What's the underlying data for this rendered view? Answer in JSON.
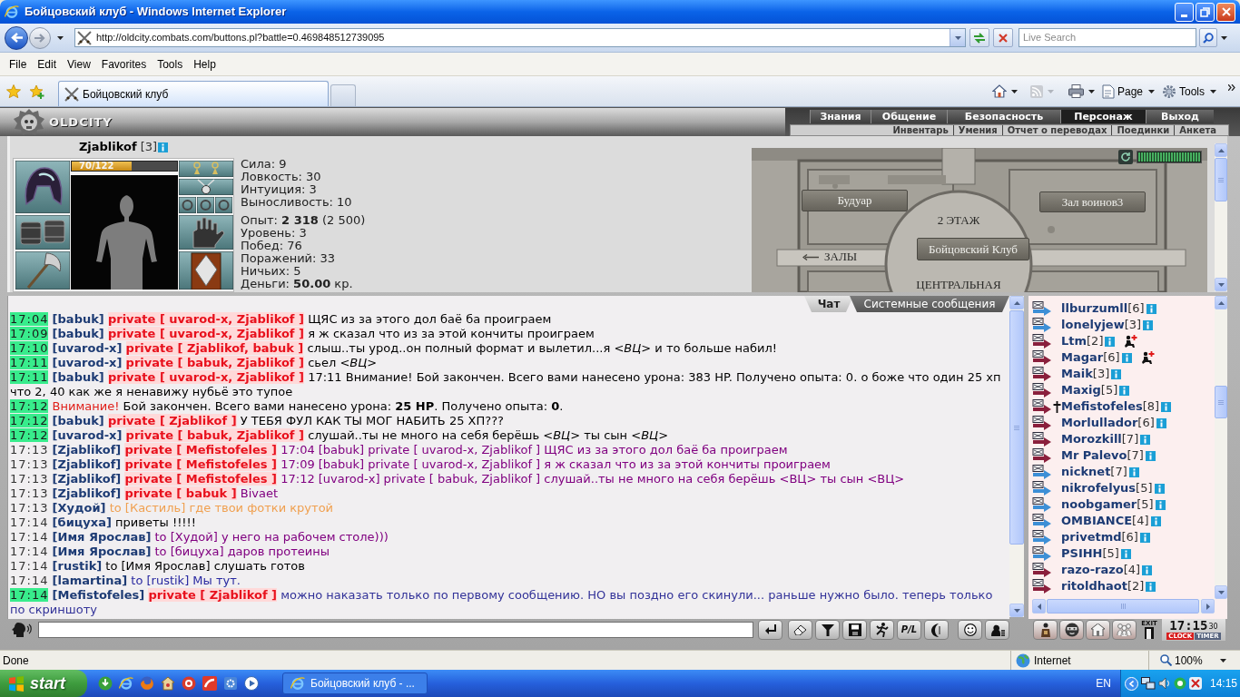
{
  "window": {
    "title": "Бойцовский клуб - Windows Internet Explorer"
  },
  "address_bar": {
    "url": "http://oldcity.combats.com/buttons.pl?battle=0.469848512739095",
    "search": {
      "placeholder": "Live Search"
    }
  },
  "menu_bar": [
    "File",
    "Edit",
    "View",
    "Favorites",
    "Tools",
    "Help"
  ],
  "tabs": [
    {
      "label": "Бойцовский клуб",
      "selected": true
    }
  ],
  "command_bar": [
    {
      "label": "Page"
    },
    {
      "label": "Tools"
    }
  ],
  "game": {
    "logo": "OLDCITY",
    "main_menu": [
      {
        "label": "Знания",
        "selected": false
      },
      {
        "label": "Общение",
        "selected": false
      },
      {
        "label": "Безопасность",
        "selected": false
      },
      {
        "label": "Персонаж",
        "selected": true
      },
      {
        "label": "Выход",
        "selected": false
      }
    ],
    "sub_menu": [
      "Инвентарь",
      "Умения",
      "Отчет о переводах",
      "Поединки",
      "Анкета"
    ],
    "character": {
      "name": "Zjablikof",
      "level": "[3]",
      "hp": {
        "reading": "70/122",
        "level": 0.57
      }
    },
    "stats": [
      [
        "Сила: 9",
        "Ловкость: 30",
        "Интуиция: 3",
        "Выносливость: 10"
      ],
      [
        "Опыт: **2 318** (2 500)",
        "Уровень: 3",
        "Побед: 76",
        "Поражений: 33",
        "Ничьих: 5",
        "Деньги: **50.00** кр."
      ]
    ],
    "map": {
      "labels": [
        {
          "text": "Будуар",
          "kind": "banner"
        },
        {
          "text": "Зал воинов3",
          "kind": "banner"
        },
        {
          "text": "2 ЭТАЖ",
          "kind": "caption"
        },
        {
          "text": "Бойцовский Клуб",
          "kind": "banner"
        },
        {
          "text": "ЗАЛЫ",
          "kind": "exit"
        },
        {
          "text": "ЦЕНТРАЛЬНАЯ",
          "kind": "caption"
        }
      ],
      "timer": {
        "level": 1
      }
    },
    "chat": {
      "tabs": [
        {
          "label": "Чат",
          "selected": true
        },
        {
          "label": "Системные сообщения",
          "selected": false
        }
      ],
      "messages": [
        {
          "time": "17:04",
          "highlight": true,
          "kind": "private",
          "sender": "[babuk]",
          "address": "private [ uvarod-x, Zjablikof ]",
          "text": "ЩЯС из за этого дол баё ба проиграем",
          "color": "#000000"
        },
        {
          "time": "17:09",
          "highlight": true,
          "kind": "private",
          "sender": "[babuk]",
          "address": "private [ uvarod-x, Zjablikof ]",
          "text": "я ж сказал что из за этой кончиты проиграем",
          "color": "#000000"
        },
        {
          "time": "17:10",
          "highlight": true,
          "kind": "private",
          "sender": "[uvarod-x]",
          "address": "private [ Zjablikof, babuk ]",
          "text": "слыш..ты урод..он полный формат и вылетил...я *<ВЦ>* и то больше набил!",
          "color": "#000000"
        },
        {
          "time": "17:11",
          "highlight": true,
          "kind": "private",
          "sender": "[uvarod-x]",
          "address": "private [ babuk, Zjablikof ]",
          "text": "сьел *<ВЦ>*",
          "color": "#000000"
        },
        {
          "time": "17:11",
          "highlight": true,
          "kind": "private",
          "sender": "[babuk]",
          "address": "private [ uvarod-x, Zjablikof ]",
          "text": "17:11 Внимание! Бой закончен. Всего вами нанесено урона: 383 HP. Получено опыта: 0. о боже что один 25 хп что 2, 40 как же я ненавижу нубьё это тупое",
          "color": "#000000"
        },
        {
          "time": "17:12",
          "highlight": true,
          "kind": "system",
          "alert": "Внимание!",
          "text": "Бой закончен. Всего вами нанесено урона: **25 HP**. Получено опыта: **0**.",
          "color": "#000000"
        },
        {
          "time": "17:12",
          "highlight": true,
          "kind": "private",
          "sender": "[babuk]",
          "address": "private [ Zjablikof ]",
          "text": "У ТЕБЯ ФУЛ КАК ТЫ МОГ НАБИТЬ 25 ХП???",
          "color": "#000000"
        },
        {
          "time": "17:12",
          "highlight": true,
          "kind": "private",
          "sender": "[uvarod-x]",
          "address": "private [ babuk, Zjablikof ]",
          "text": "слушай..ты не много на себя берёшь *<ВЦ>* ты сын *<ВЦ>*",
          "color": "#000000"
        },
        {
          "time": "17:13",
          "highlight": false,
          "kind": "private",
          "sender": "[Zjablikof]",
          "address": "private [ Mefistofeles ]",
          "text": "17:04 [babuk] private [ uvarod-x, Zjablikof ] ЩЯС из за этого дол баё ба проиграем",
          "color": "#800080"
        },
        {
          "time": "17:13",
          "highlight": false,
          "kind": "private",
          "sender": "[Zjablikof]",
          "address": "private [ Mefistofeles ]",
          "text": "17:09 [babuk] private [ uvarod-x, Zjablikof ] я ж сказал что из за этой кончиты проиграем",
          "color": "#800080"
        },
        {
          "time": "17:13",
          "highlight": false,
          "kind": "private",
          "sender": "[Zjablikof]",
          "address": "private [ Mefistofeles ]",
          "text": "17:12 [uvarod-x] private [ babuk, Zjablikof ] слушай..ты не много на себя берёшь <ВЦ> ты сын <ВЦ>",
          "color": "#800080"
        },
        {
          "time": "17:13",
          "highlight": false,
          "kind": "private",
          "sender": "[Zjablikof]",
          "address": "private [ babuk ]",
          "text": "Bivaet",
          "color": "#800080"
        },
        {
          "time": "17:13",
          "highlight": false,
          "kind": "public",
          "sender": "[Худой]",
          "text": "to [Кастиль] где твои фотки крутой",
          "color": "#f0a050"
        },
        {
          "time": "17:14",
          "highlight": false,
          "kind": "public",
          "sender": "[бицуха]",
          "text": "приветы !!!!!",
          "color": "#000000"
        },
        {
          "time": "17:14",
          "highlight": false,
          "kind": "public",
          "sender": "[Имя Ярослав]",
          "text": "to [Худой] у него на рабочем столе)))",
          "color": "#800080"
        },
        {
          "time": "17:14",
          "highlight": false,
          "kind": "public",
          "sender": "[Имя Ярослав]",
          "text": "to [бицуха] даров протеины",
          "color": "#800080"
        },
        {
          "time": "17:14",
          "highlight": false,
          "kind": "public",
          "sender": "[rustik]",
          "text": "to [Имя Ярослав] слушать готов",
          "color": "#000000"
        },
        {
          "time": "17:14",
          "highlight": false,
          "kind": "public",
          "sender": "[lamartina]",
          "text": "to [rustik] Мы тут.",
          "color": "#2828a0"
        },
        {
          "time": "17:14",
          "highlight": true,
          "kind": "private",
          "sender": "[Mefistofeles]",
          "address": "private [ Zjablikof ]",
          "text": "можно наказать только по первому сообщению. НО вы поздно его скинули... раньше нужно было. теперь только по скриншоту",
          "color": "#333399"
        }
      ]
    },
    "users": [
      {
        "name": "llburzumll",
        "level": "[6]",
        "color": "#3d8fd6",
        "kind": "plain"
      },
      {
        "name": "lonelyjew",
        "level": "[3]",
        "color": "#3d8fd6",
        "kind": "plain"
      },
      {
        "name": "Ltm",
        "level": "[2]",
        "color": "#8a1f3c",
        "kind": "plus"
      },
      {
        "name": "Magar",
        "level": "[6]",
        "color": "#8a1f3c",
        "kind": "plus"
      },
      {
        "name": "Maik",
        "level": "[3]",
        "color": "#8a1f3c",
        "kind": "plain"
      },
      {
        "name": "Maxig",
        "level": "[5]",
        "color": "#8a1f3c",
        "kind": "plain"
      },
      {
        "name": "Mefistofeles",
        "level": "[8]",
        "color": "#8a1f3c",
        "kind": "cross"
      },
      {
        "name": "Morlullador",
        "level": "[6]",
        "color": "#8a1f3c",
        "kind": "plain"
      },
      {
        "name": "Morozkill",
        "level": "[7]",
        "color": "#8a1f3c",
        "kind": "plain"
      },
      {
        "name": "Mr Palevo",
        "level": "[7]",
        "color": "#8a1f3c",
        "kind": "plain"
      },
      {
        "name": "nicknet",
        "level": "[7]",
        "color": "#3d8fd6",
        "kind": "plain"
      },
      {
        "name": "nikrofelyus",
        "level": "[5]",
        "color": "#3d8fd6",
        "kind": "plain"
      },
      {
        "name": "noobgamer",
        "level": "[5]",
        "color": "#3d8fd6",
        "kind": "plain"
      },
      {
        "name": "OMBIANCE",
        "level": "[4]",
        "color": "#3d8fd6",
        "kind": "plain"
      },
      {
        "name": "privetmd",
        "level": "[6]",
        "color": "#3d8fd6",
        "kind": "plain"
      },
      {
        "name": "PSIHH",
        "level": "[5]",
        "color": "#3d8fd6",
        "kind": "plain"
      },
      {
        "name": "razo-razo",
        "level": "[4]",
        "color": "#8a1f3c",
        "kind": "plain"
      },
      {
        "name": "ritoldhaot",
        "level": "[2]",
        "color": "#8a1f3c",
        "kind": "plain"
      }
    ],
    "chat_toolbar": {
      "pl_label": "P/L",
      "exit_label": "EXIT"
    },
    "clock": {
      "time": "17:15",
      "seconds": "30",
      "modes": [
        {
          "label": "CLOCK",
          "selected": true
        },
        {
          "label": "TIMER",
          "selected": false
        }
      ]
    }
  },
  "status_bar": {
    "text": "Done",
    "zone": "Internet",
    "zoom": "100%"
  },
  "taskbar": {
    "start": "start",
    "task": "Бойцовский клуб - ...",
    "language": "EN",
    "time": "14:15"
  }
}
